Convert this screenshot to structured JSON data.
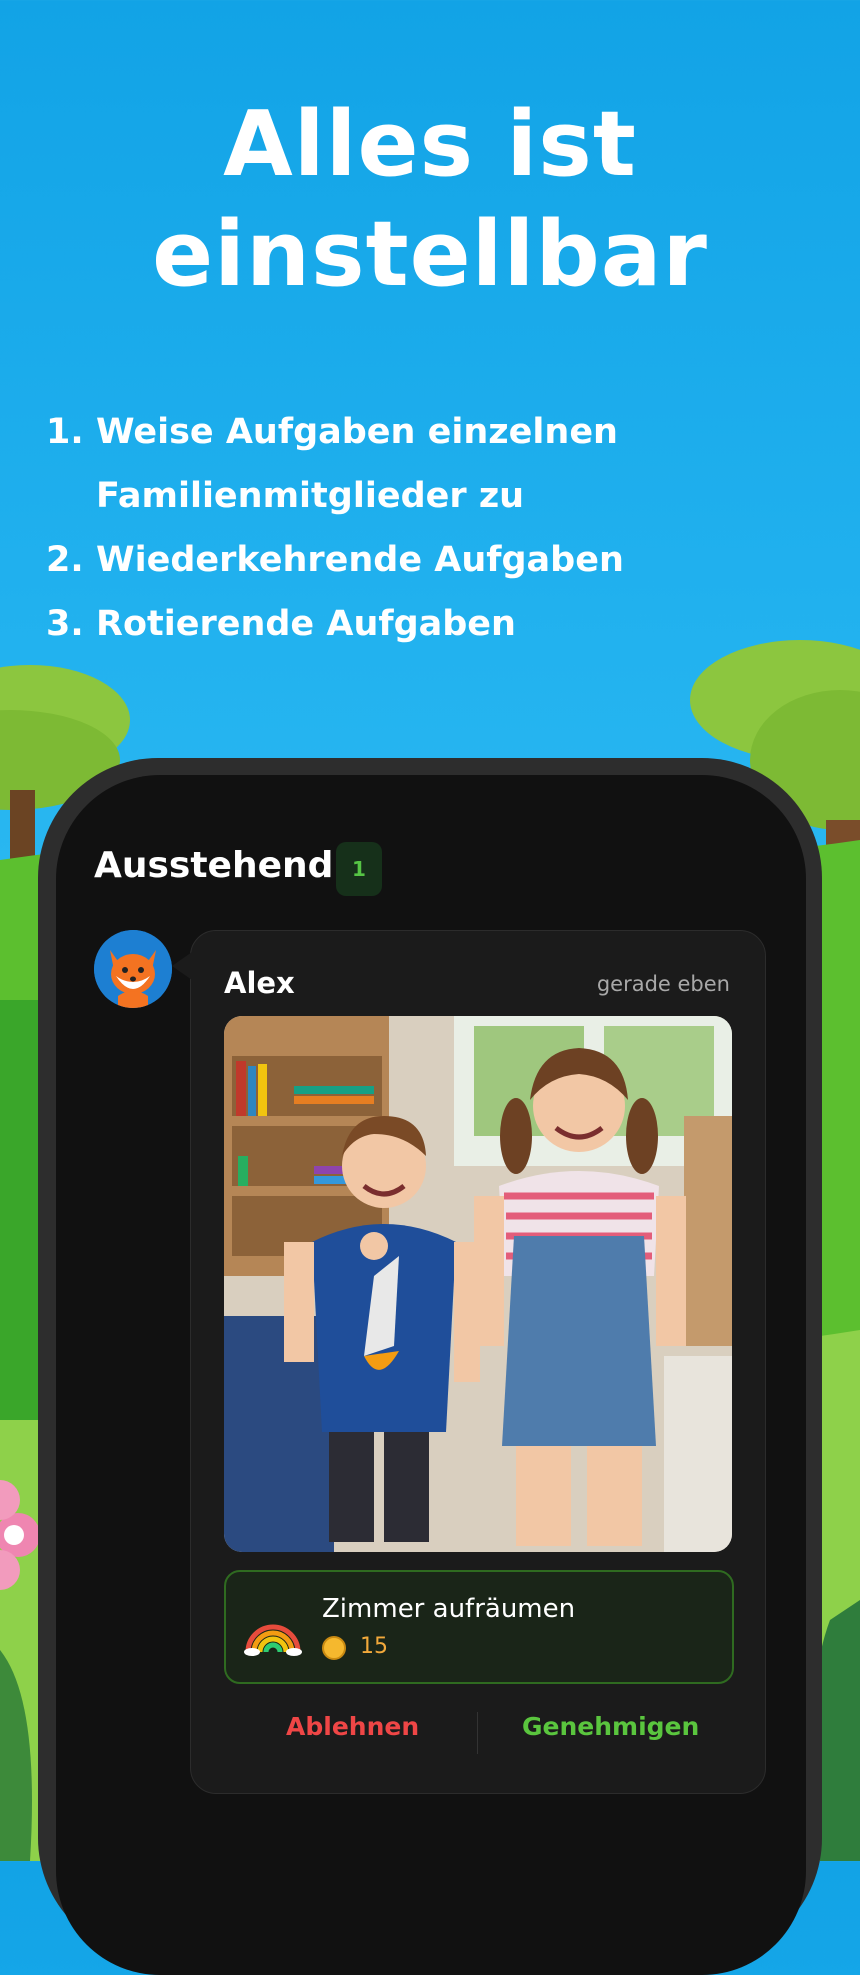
{
  "headline": {
    "line1": "Alles ist",
    "line2": "einstellbar"
  },
  "steps": [
    {
      "num": "1.",
      "lines": [
        "Weise Aufgaben einzelnen",
        "Familienmitglieder zu"
      ]
    },
    {
      "num": "2.",
      "lines": [
        "Wiederkehrende Aufgaben"
      ]
    },
    {
      "num": "3.",
      "lines": [
        "Rotierende Aufgaben"
      ]
    }
  ],
  "app": {
    "section_title": "Ausstehend",
    "pending_count": "1",
    "submission": {
      "user_name": "Alex",
      "time": "gerade eben",
      "task_title": "Zimmer aufräumen",
      "reward": "15",
      "reject_label": "Ablehnen",
      "approve_label": "Genehmigen"
    }
  },
  "colors": {
    "sky": "#1aa6e8",
    "grass": "#4cb52d",
    "screen": "#111111",
    "reject": "#ef4646",
    "approve": "#5ac53e",
    "coin": "#f2a93b"
  }
}
